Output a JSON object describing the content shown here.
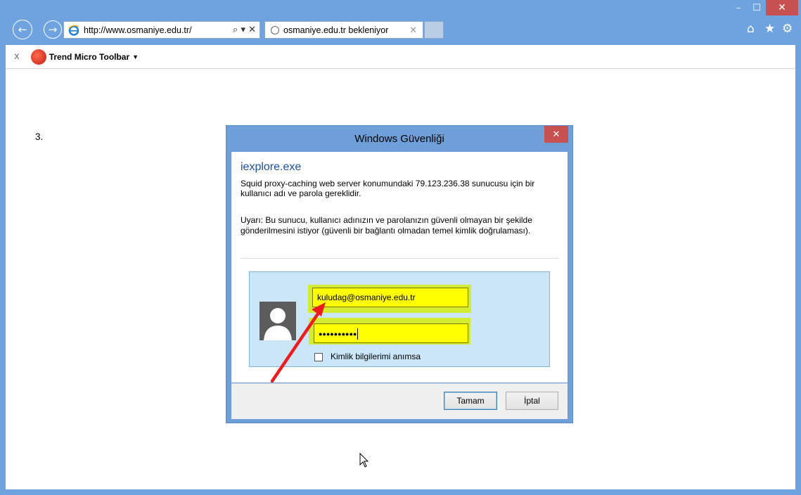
{
  "window": {
    "minimize": "–",
    "maximize": "☐",
    "close": "✕"
  },
  "browser": {
    "address": "http://www.osmaniye.edu.tr/",
    "address_tools": "⌕ ▾ ✕",
    "tab_label": "osmaniye.edu.tr bekleniyor",
    "tab_close": "✕",
    "right_icons": [
      "⌂",
      "★",
      "⚙"
    ]
  },
  "toolbar": {
    "close": "x",
    "label": "Trend Micro Toolbar",
    "arrow": "▼"
  },
  "page": {
    "step": "3."
  },
  "dialog": {
    "title": "Windows Güvenliği",
    "close": "✕",
    "app_name": "iexplore.exe",
    "message": "Squid proxy-caching web server konumundaki 79.123.236.38 sunucusu için bir kullanıcı adı ve parola gereklidir.",
    "warning": "Uyarı: Bu sunucu, kullanıcı adınızın ve parolanızın güvenli olmayan bir şekilde gönderilmesini istiyor (güvenli bir bağlantı olmadan temel kimlik doğrulaması).",
    "username": "kuludag@osmaniye.edu.tr",
    "password_mask": "●●●●●●●●●●",
    "remember_label": "Kimlik bilgilerimi anımsa",
    "ok_label": "Tamam",
    "cancel_label": "İptal"
  },
  "colors": {
    "frame": "#6fa3e0",
    "highlight": "#d4ec2f",
    "field": "#ffff00",
    "arrow": "#ee1c1c"
  }
}
